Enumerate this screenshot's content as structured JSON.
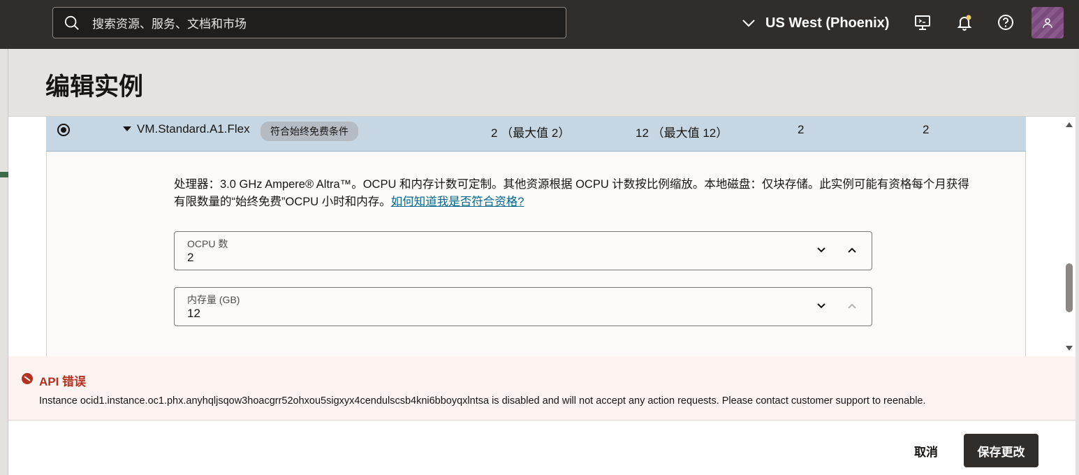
{
  "topbar": {
    "search_placeholder": "搜索资源、服务、文档和市场",
    "region": "US West (Phoenix)"
  },
  "icons": {
    "search": "search-icon",
    "region_dropdown": "chevron-down-icon",
    "cloud_shell": "cloud-shell-icon",
    "notifications": "bell-icon",
    "help": "help-icon",
    "profile": "user-icon"
  },
  "panel": {
    "title": "编辑实例"
  },
  "shape_row": {
    "name": "VM.Standard.A1.Flex",
    "badge": "符合始终免费条件",
    "ocpu": "2 （最大值 2）",
    "memory": "12 （最大值 12）",
    "col4": "2",
    "col5": "2"
  },
  "detail": {
    "description": "处理器：3.0 GHz Ampere® Altra™。OCPU 和内存计数可定制。其他资源根据 OCPU 计数按比例缩放。本地磁盘：仅块存储。此实例可能有资格每个月获得有限数量的“始终免费”OCPU 小时和内存。",
    "link": "如何知道我是否符合资格?",
    "ocpu_field": {
      "label": "OCPU 数",
      "value": "2"
    },
    "memory_field": {
      "label": "内存量 (GB)",
      "value": "12"
    }
  },
  "error": {
    "title": "API 错误",
    "message": "Instance ocid1.instance.oc1.phx.anyhqljsqow3hoacgrr52ohxou5sigxyx4cendulscsb4kni6bboyqxlntsa is disabled and will not accept any action requests. Please contact customer support to reenable."
  },
  "footer": {
    "cancel": "取消",
    "save": "保存更改"
  },
  "colors": {
    "topbar": "#312d2a",
    "selected_row": "#c6d6e2",
    "link": "#00688c",
    "error_title": "#b3311f",
    "primary_button": "#312d2a"
  }
}
